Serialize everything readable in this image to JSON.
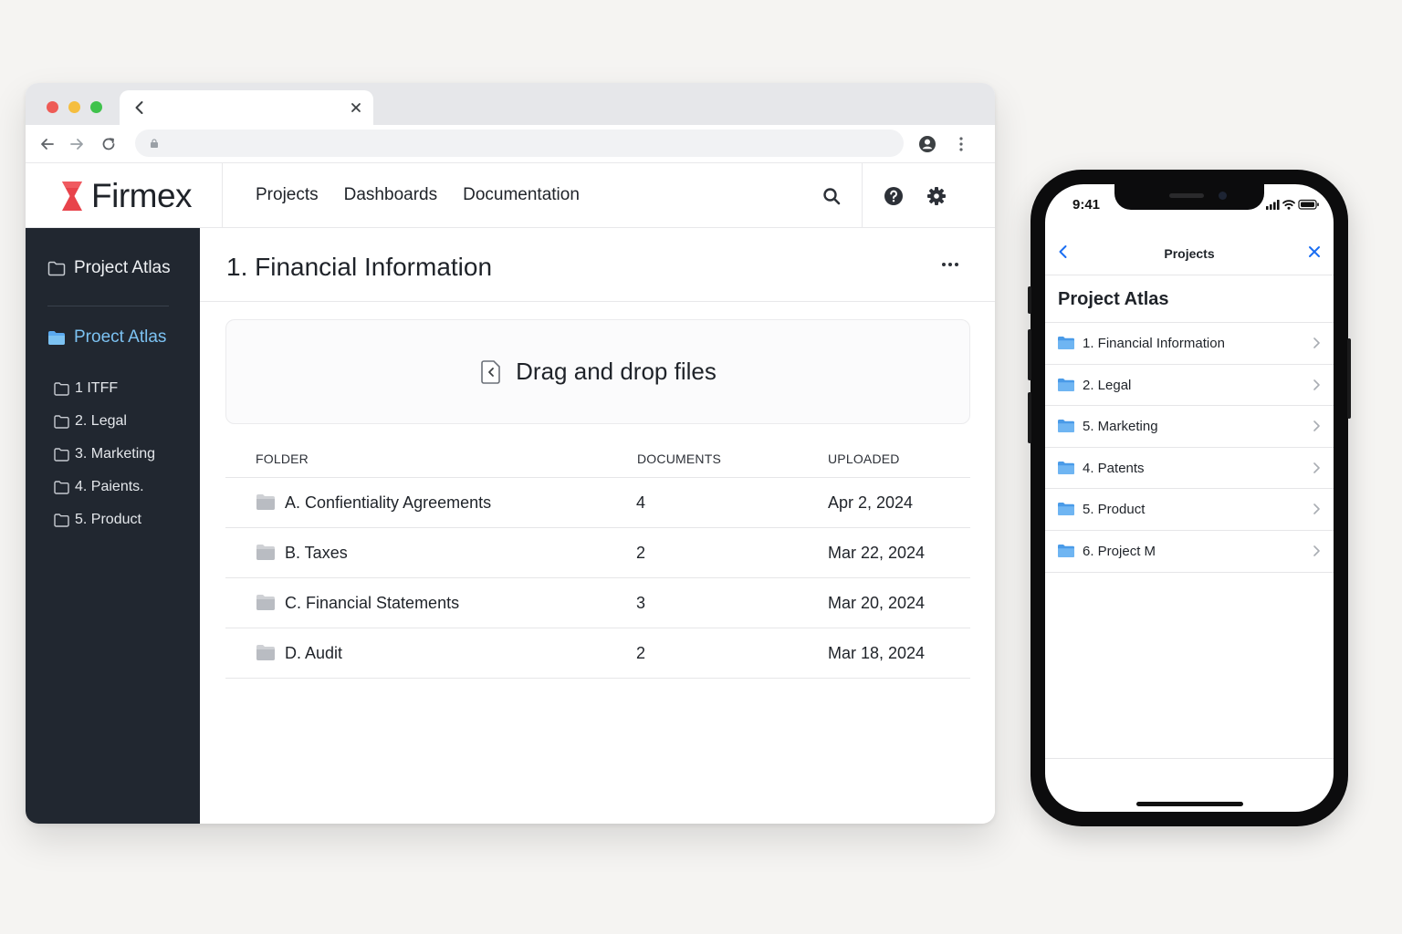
{
  "browser": {
    "header": {
      "logo_text": "Firmex",
      "nav": [
        "Projects",
        "Dashboards",
        "Documentation"
      ]
    },
    "sidebar": {
      "top_item": "Project Atlas",
      "active_item": "Proect Atlas",
      "items": [
        "1 ITFF",
        "2. Legal",
        "3. Marketing",
        "4. Paients.",
        "5. Product"
      ]
    },
    "main": {
      "title": "1. Financial Information",
      "dropzone_label": "Drag and drop files",
      "table": {
        "headers": {
          "folder": "FOLDER",
          "documents": "DOCUMENTS",
          "uploaded": "UPLOADED"
        },
        "rows": [
          {
            "folder": "A. Confientiality Agreements",
            "documents": "4",
            "uploaded": "Apr 2, 2024"
          },
          {
            "folder": "B. Taxes",
            "documents": "2",
            "uploaded": "Mar 22, 2024"
          },
          {
            "folder": "C. Financial Statements",
            "documents": "3",
            "uploaded": "Mar 20, 2024"
          },
          {
            "folder": "D. Audit",
            "documents": "2",
            "uploaded": "Mar 18, 2024"
          }
        ]
      }
    }
  },
  "phone": {
    "time": "9:41",
    "nav_title": "Projects",
    "heading": "Project Atlas",
    "items": [
      "1. Financial Information",
      "2. Legal",
      "5. Marketing",
      "4. Patents",
      "5. Product",
      "6. Project M"
    ]
  },
  "colors": {
    "sidebar_bg": "#212730",
    "sidebar_active": "#7cc2f2",
    "brand_red": "#e8434b",
    "folder_blue": "#5aa9ef",
    "ios_blue": "#1a6ef2"
  }
}
